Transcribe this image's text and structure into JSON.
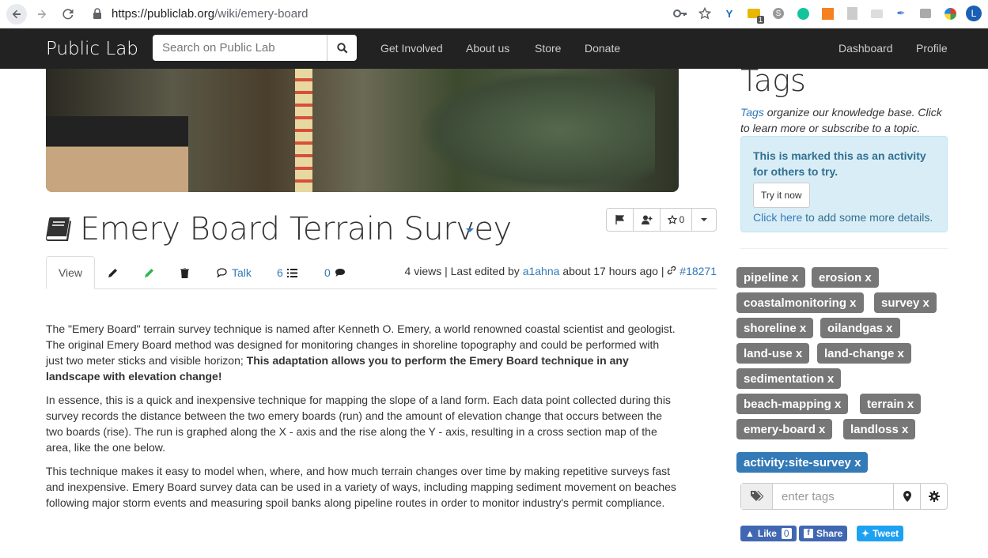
{
  "browser": {
    "url_host": "https://publiclab.org",
    "url_path": "/wiki/emery-board",
    "profile_initial": "L",
    "ext_badge": "1"
  },
  "navbar": {
    "brand": "Public Lab",
    "search_placeholder": "Search on Public Lab",
    "links": [
      "Get Involved",
      "About us",
      "Store",
      "Donate"
    ],
    "right_links": [
      "Dashboard",
      "Profile"
    ]
  },
  "page": {
    "title": "Emery Board Terrain Survey",
    "like_count": "0",
    "tabs": {
      "view": "View",
      "talk": "Talk",
      "revisions_count": "6",
      "comments_count": "0"
    },
    "meta": {
      "views": "4 views",
      "last_edited_prefix": "| Last edited by",
      "author": "a1ahna",
      "time": "about 17 hours ago",
      "separator": "|",
      "node_id": "#18271"
    },
    "body": {
      "p1_plain": "The \"Emery Board\" terrain survey technique is named after Kenneth O. Emery, a world renowned coastal scientist and geologist. The original Emery Board method was designed for monitoring changes in shoreline topography and could be performed with just two meter sticks and visible horizon; ",
      "p1_bold": "This adaptation allows you to perform the Emery Board technique in any landscape with elevation change!",
      "p2": "In essence, this is a quick and inexpensive technique for mapping the slope of a land form. Each data point collected during this survey records the distance between the two emery boards (run) and the amount of elevation change that occurs between the two boards (rise). The run is graphed along the X - axis and the rise along the Y - axis, resulting in a cross section map of the area, like the one below.",
      "p3": "This technique makes it easy to model when, where, and how much terrain changes over time by making repetitive surveys fast and inexpensive. Emery Board survey data can be used in a variety of ways, including mapping sediment movement on beaches following major storm events and measuring spoil banks along pipeline routes in order to monitor industry's permit compliance."
    }
  },
  "sidebar": {
    "title": "Tags",
    "desc_link": "Tags",
    "desc_text": " organize our knowledge base. Click to learn more or subscribe to a topic.",
    "activity": {
      "text": "This is marked this as an activity for others to try.",
      "button": "Try it now",
      "link": "Click here",
      "link_suffix": " to add some more details."
    },
    "tags": [
      "pipeline x",
      "erosion x",
      "coastalmonitoring x",
      "survey x",
      "shoreline x",
      "oilandgas x",
      "land-use x",
      "land-change x",
      "sedimentation x",
      "beach-mapping x",
      "terrain x",
      "emery-board x",
      "landloss x"
    ],
    "activity_tag": "activity:site-survey x",
    "tag_placeholder": "enter tags",
    "social": {
      "like": "Like",
      "like_count": "0",
      "share": "Share",
      "tweet": "Tweet"
    }
  },
  "colors": {
    "navbar_bg": "#222222",
    "link": "#337ab7",
    "tag_bg": "#777777",
    "activity_tag_bg": "#337ab7",
    "alert_bg": "#d9edf7"
  }
}
